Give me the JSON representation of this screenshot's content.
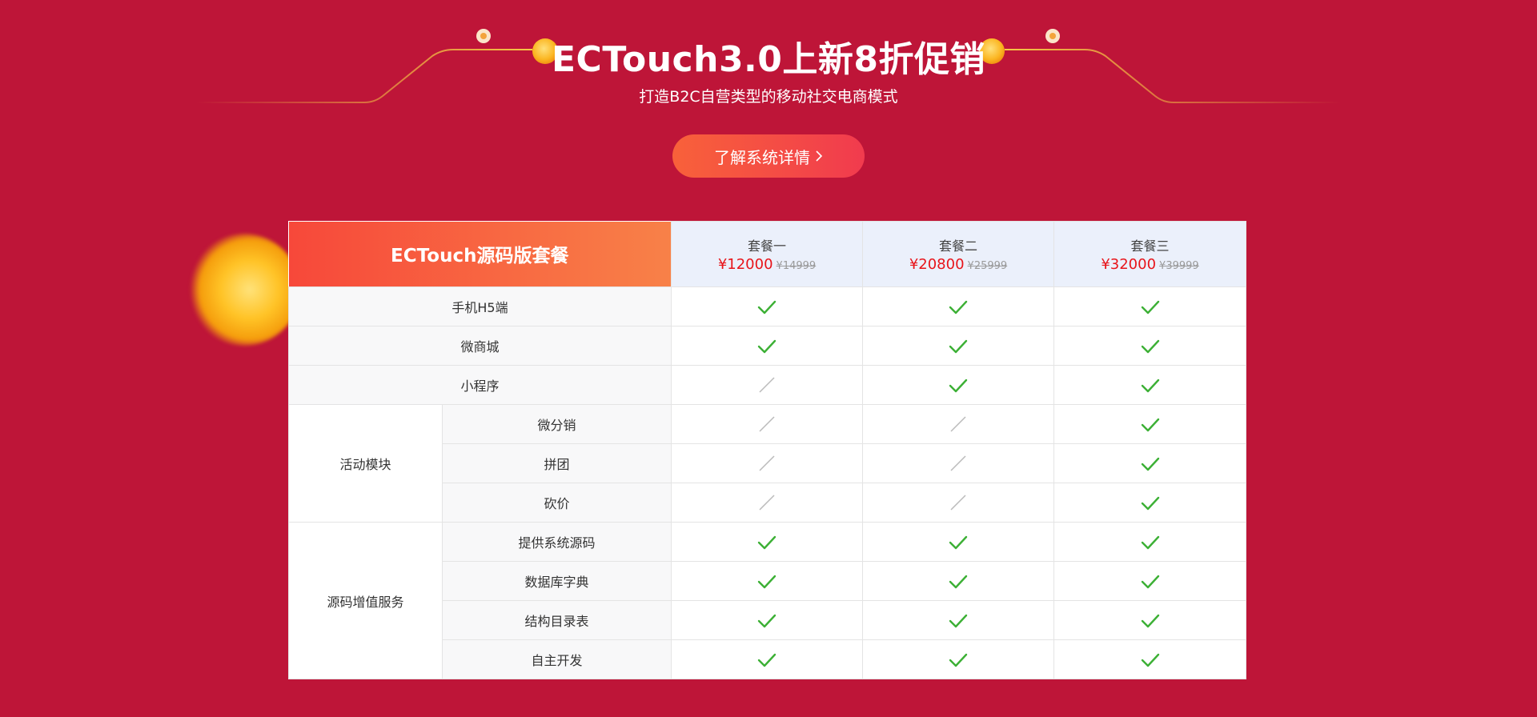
{
  "hero": {
    "title": "ECTouch3.0上新8折促销",
    "subtitle": "打造B2C自营类型的移动社交电商模式",
    "cta_label": "了解系统详情",
    "cta_icon": "chevron-right-icon"
  },
  "colors": {
    "background": "#be1538",
    "accent": "#f8613a",
    "price": "#e8141a",
    "check": "#3cb035",
    "dash": "#bbbbbb"
  },
  "table": {
    "brand_header": "ECTouch源码版套餐",
    "plans": [
      {
        "name": "套餐一",
        "price": "¥12000",
        "old_price": "¥14999"
      },
      {
        "name": "套餐二",
        "price": "¥20800",
        "old_price": "¥25999"
      },
      {
        "name": "套餐三",
        "price": "¥32000",
        "old_price": "¥39999"
      }
    ],
    "rows": [
      {
        "group": "",
        "feature": "手机H5端",
        "support": [
          true,
          true,
          true
        ]
      },
      {
        "group": "",
        "feature": "微商城",
        "support": [
          true,
          true,
          true
        ]
      },
      {
        "group": "",
        "feature": "小程序",
        "support": [
          false,
          true,
          true
        ]
      },
      {
        "group": "活动模块",
        "feature": "微分销",
        "support": [
          false,
          false,
          true
        ]
      },
      {
        "group": "活动模块",
        "feature": "拼团",
        "support": [
          false,
          false,
          true
        ]
      },
      {
        "group": "活动模块",
        "feature": "砍价",
        "support": [
          false,
          false,
          true
        ]
      },
      {
        "group": "源码增值服务",
        "feature": "提供系统源码",
        "support": [
          true,
          true,
          true
        ]
      },
      {
        "group": "源码增值服务",
        "feature": "数据库字典",
        "support": [
          true,
          true,
          true
        ]
      },
      {
        "group": "源码增值服务",
        "feature": "结构目录表",
        "support": [
          true,
          true,
          true
        ]
      },
      {
        "group": "源码增值服务",
        "feature": "自主开发",
        "support": [
          true,
          true,
          true
        ]
      }
    ]
  }
}
